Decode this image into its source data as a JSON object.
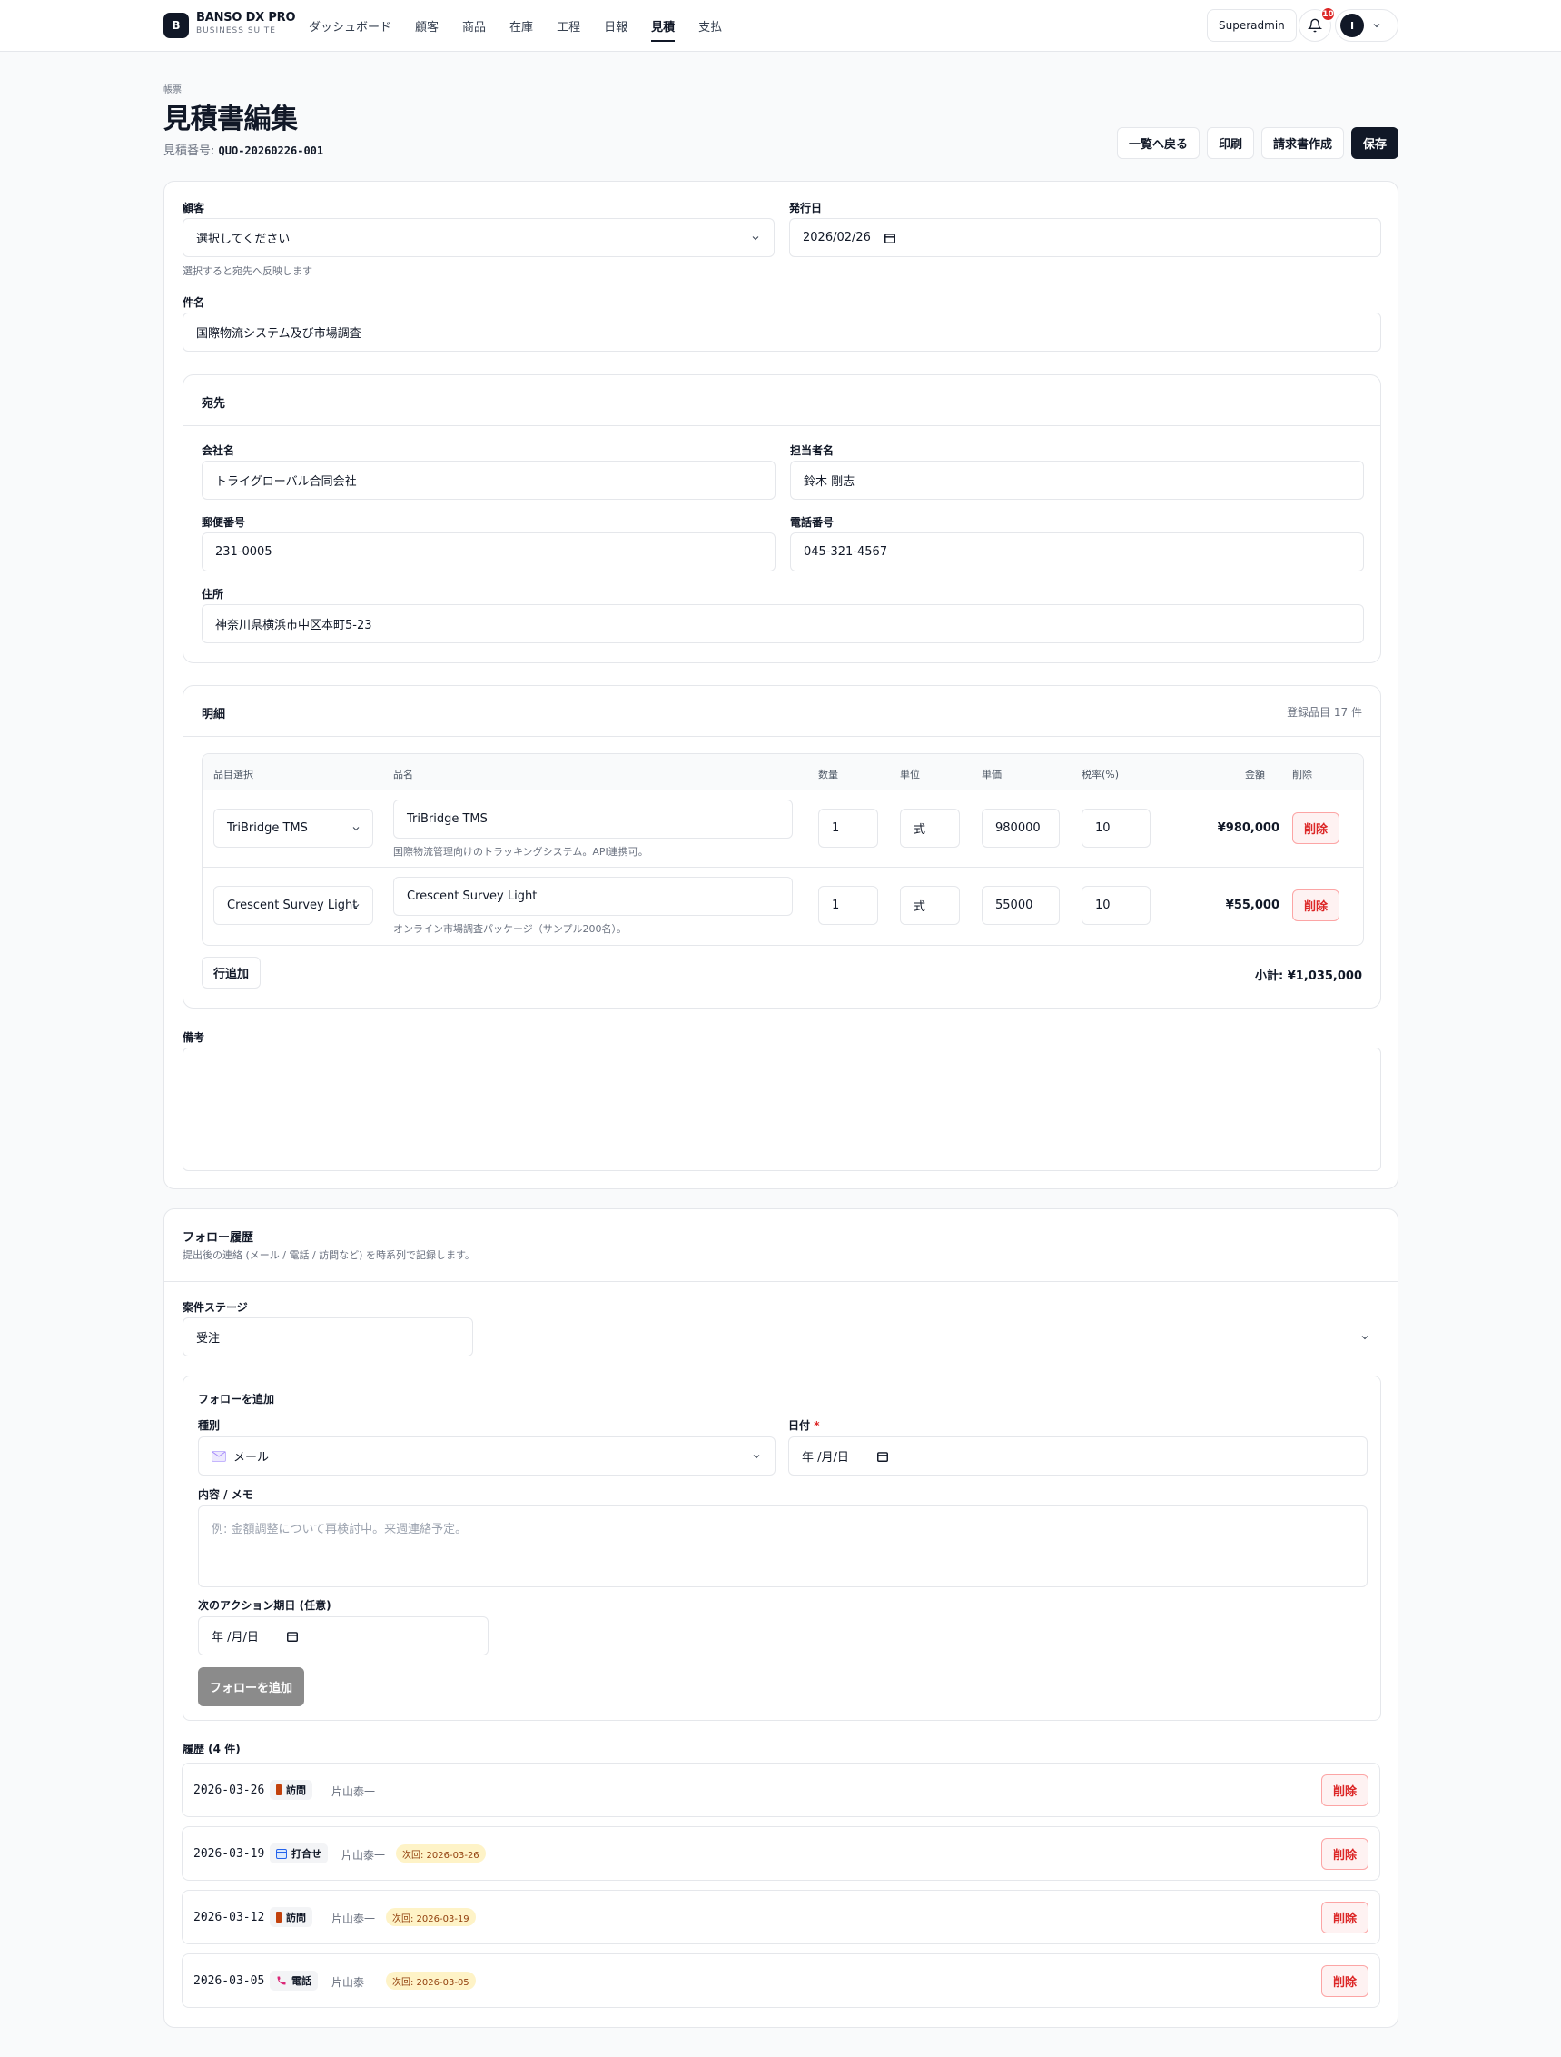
{
  "brand": {
    "badge": "B",
    "name": "BANSO DX PRO",
    "sub": "BUSINESS SUITE"
  },
  "nav": [
    {
      "label": "ダッシュボード",
      "active": false
    },
    {
      "label": "顧客",
      "active": false
    },
    {
      "label": "商品",
      "active": false
    },
    {
      "label": "在庫",
      "active": false
    },
    {
      "label": "工程",
      "active": false
    },
    {
      "label": "日報",
      "active": false
    },
    {
      "label": "見積",
      "active": true
    },
    {
      "label": "支払",
      "active": false
    }
  ],
  "header_right": {
    "role": "Superadmin",
    "notifications": "10",
    "avatar_initial": "I"
  },
  "page": {
    "breadcrumb": "帳票",
    "title": "見積書編集",
    "number_label": "見積番号:",
    "number": "QUO-20260226-001"
  },
  "actions": {
    "back": "一覧へ戻る",
    "print": "印刷",
    "invoice": "請求書作成",
    "save": "保存"
  },
  "form": {
    "customer_label": "顧客",
    "customer_value": "選択してください",
    "customer_hint": "選択すると宛先へ反映します",
    "issue_date_label": "発行日",
    "issue_date_value": "2026/02/26",
    "subject_label": "件名",
    "subject_value": "国際物流システム及び市場調査"
  },
  "recipient": {
    "title": "宛先",
    "company_label": "会社名",
    "company_value": "トライグローバル合同会社",
    "contact_label": "担当者名",
    "contact_value": "鈴木 剛志",
    "zip_label": "郵便番号",
    "zip_value": "231-0005",
    "phone_label": "電話番号",
    "phone_value": "045-321-4567",
    "address_label": "住所",
    "address_value": "神奈川県横浜市中区本町5-23"
  },
  "items": {
    "title": "明細",
    "count_text": "登録品目 17 件",
    "columns": {
      "select": "品目選択",
      "name": "品名",
      "qty": "数量",
      "unit": "単位",
      "price": "単価",
      "tax": "税率(%)",
      "amount": "金額",
      "delete": "削除"
    },
    "rows": [
      {
        "select": "TriBridge TMS",
        "name": "TriBridge TMS",
        "desc": "国際物流管理向けのトラッキングシステム。API連携可。",
        "qty": "1",
        "unit": "式",
        "price": "980000",
        "tax": "10",
        "amount": "¥980,000",
        "delete": "削除"
      },
      {
        "select": "Crescent Survey Light",
        "name": "Crescent Survey Light",
        "desc": "オンライン市場調査パッケージ（サンプル200名）。",
        "qty": "1",
        "unit": "式",
        "price": "55000",
        "tax": "10",
        "amount": "¥55,000",
        "delete": "削除"
      }
    ],
    "add_row": "行追加",
    "subtotal": "小計: ¥1,035,000"
  },
  "notes": {
    "label": "備考",
    "value": ""
  },
  "follow": {
    "title": "フォロー履歴",
    "subtitle": "提出後の連絡 (メール / 電話 / 訪問など) を時系列で記録します。",
    "stage_label": "案件ステージ",
    "stage_value": "受注",
    "add_title": "フォローを追加",
    "type_label": "種別",
    "type_value": "メール",
    "date_label": "日付",
    "date_required": "*",
    "date_value": "年 /月/日",
    "memo_label": "内容 / メモ",
    "memo_placeholder": "例: 金額調整について再検討中。来週連絡予定。",
    "next_label": "次のアクション期日 (任意)",
    "next_value": "年 /月/日",
    "add_button": "フォローを追加",
    "history_label": "履歴 (4 件)",
    "history": [
      {
        "date": "2026-03-26",
        "type": "訪問",
        "icon": "door-icon",
        "color": "#c2410c",
        "who": "片山泰一",
        "next": "",
        "delete": "削除"
      },
      {
        "date": "2026-03-19",
        "type": "打合せ",
        "icon": "calendar-icon",
        "color": "#2563eb",
        "who": "片山泰一",
        "next": "次回: 2026-03-26",
        "delete": "削除"
      },
      {
        "date": "2026-03-12",
        "type": "訪問",
        "icon": "door-icon",
        "color": "#c2410c",
        "who": "片山泰一",
        "next": "次回: 2026-03-19",
        "delete": "削除"
      },
      {
        "date": "2026-03-05",
        "type": "電話",
        "icon": "phone-icon",
        "color": "#db2777",
        "who": "片山泰一",
        "next": "次回: 2026-03-05",
        "delete": "削除"
      }
    ]
  },
  "colors": {
    "primary": "#111827",
    "danger": "#dc2626",
    "border": "#e5e7eb",
    "muted": "#6b7280",
    "badge_next": "#fef3c7"
  }
}
